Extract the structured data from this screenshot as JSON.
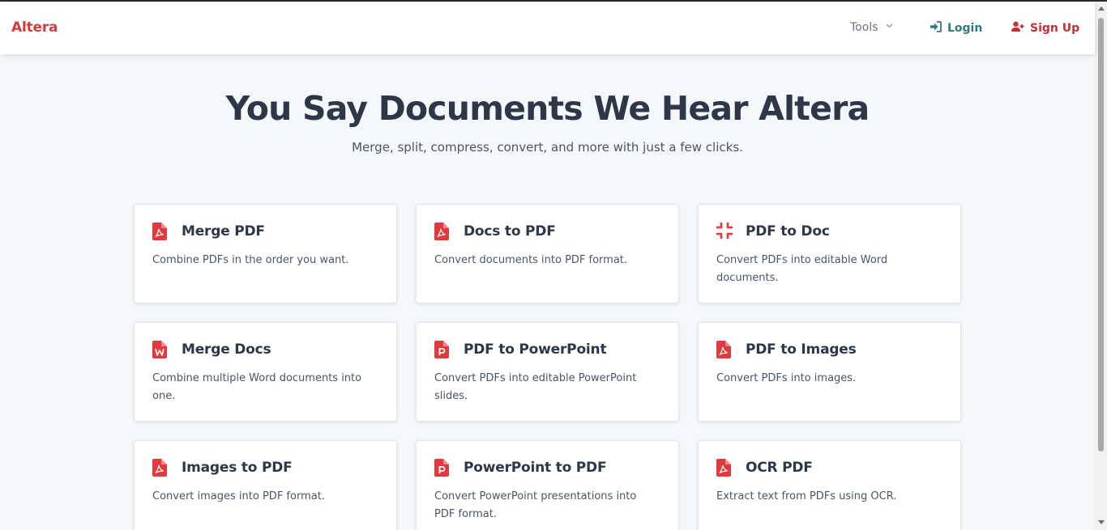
{
  "nav": {
    "brand": "Altera",
    "tools_label": "Tools",
    "login_label": "Login",
    "signup_label": "Sign Up"
  },
  "hero": {
    "title": "You Say Documents We Hear Altera",
    "subtitle": "Merge, split, compress, convert, and more with just a few clicks."
  },
  "tools": [
    {
      "title": "Merge PDF",
      "desc": "Combine PDFs in the order you want.",
      "icon": "pdf-file-icon"
    },
    {
      "title": "Docs to PDF",
      "desc": "Convert documents into PDF format.",
      "icon": "pdf-file-icon"
    },
    {
      "title": "PDF to Doc",
      "desc": "Convert PDFs into editable Word documents.",
      "icon": "compress-icon"
    },
    {
      "title": "Merge Docs",
      "desc": "Combine multiple Word documents into one.",
      "icon": "word-file-icon"
    },
    {
      "title": "PDF to PowerPoint",
      "desc": "Convert PDFs into editable PowerPoint slides.",
      "icon": "powerpoint-file-icon"
    },
    {
      "title": "PDF to Images",
      "desc": "Convert PDFs into images.",
      "icon": "pdf-file-icon"
    },
    {
      "title": "Images to PDF",
      "desc": "Convert images into PDF format.",
      "icon": "pdf-file-icon"
    },
    {
      "title": "PowerPoint to PDF",
      "desc": "Convert PowerPoint presentations into PDF format.",
      "icon": "powerpoint-file-icon"
    },
    {
      "title": "OCR PDF",
      "desc": "Extract text from PDFs using OCR.",
      "icon": "pdf-file-icon"
    }
  ],
  "colors": {
    "brand": "#d63b3b",
    "login": "#2f7a78",
    "signup": "#c53030",
    "icon_red": "#e0393e",
    "page_bg": "#f5f8fb",
    "heading": "#2d3748"
  }
}
